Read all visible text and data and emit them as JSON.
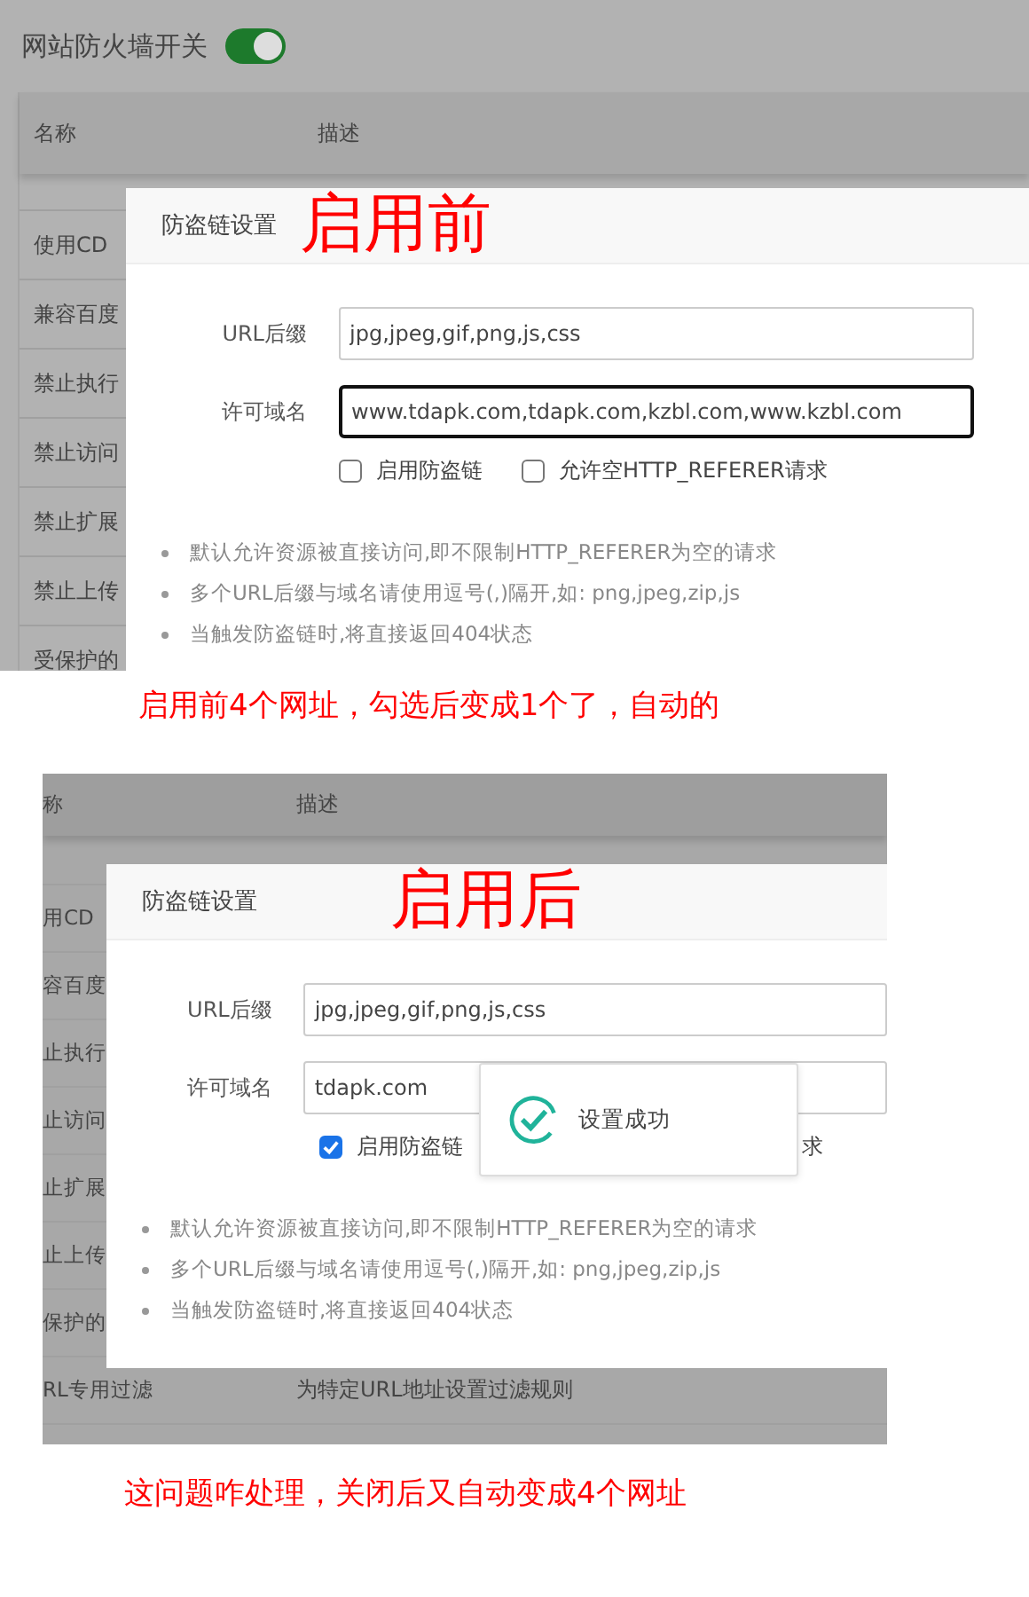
{
  "panels": [
    {
      "switch": {
        "label": "网站防火墙开关",
        "on": true
      },
      "columns": [
        "名称",
        "描述"
      ],
      "rows": [
        {
          "name": "使用CD"
        },
        {
          "name": "兼容百度"
        },
        {
          "name": "禁止执行"
        },
        {
          "name": "禁止访问"
        },
        {
          "name": "禁止扩展"
        },
        {
          "name": "禁止上传"
        },
        {
          "name": "受保护的"
        }
      ],
      "dialog": {
        "title": "防盗链设置",
        "stamp": "启用前",
        "url_suffix": {
          "label": "URL后缀",
          "value": "jpg,jpeg,gif,png,js,css"
        },
        "domains": {
          "label": "许可域名",
          "value": "www.tdapk.com,tdapk.com,kzbl.com,www.kzbl.com",
          "focused": true
        },
        "checkboxes": [
          {
            "label": "启用防盗链",
            "checked": false
          },
          {
            "label": "允许空HTTP_REFERER请求",
            "checked": false
          }
        ],
        "notes": [
          "默认允许资源被直接访问,即不限制HTTP_REFERER为空的请求",
          "多个URL后缀与域名请使用逗号(,)隔开,如: png,jpeg,zip,js",
          "当触发防盗链时,将直接返回404状态"
        ]
      },
      "caption": "启用前4个网址，勾选后变成1个了，自动的"
    },
    {
      "columns": [
        "称",
        "描述"
      ],
      "rows": [
        {
          "name": "用CD"
        },
        {
          "name": "容百度"
        },
        {
          "name": "止执行"
        },
        {
          "name": "止访问"
        },
        {
          "name": "止扩展"
        },
        {
          "name": "止上传"
        },
        {
          "name": "保护的"
        }
      ],
      "rows_after": [
        {
          "name": "RL专用过滤",
          "description": "为特定URL地址设置过滤规则"
        }
      ],
      "dialog": {
        "title": "防盗链设置",
        "stamp": "启用后",
        "url_suffix": {
          "label": "URL后缀",
          "value": "jpg,jpeg,gif,png,js,css"
        },
        "domains": {
          "label": "许可域名",
          "value": "tdapk.com",
          "focused": false
        },
        "checkboxes": [
          {
            "label": "启用防盗链",
            "checked": true
          }
        ],
        "hidden_label_tail": "求",
        "toast": {
          "text": "设置成功"
        },
        "notes": [
          "默认允许资源被直接访问,即不限制HTTP_REFERER为空的请求",
          "多个URL后缀与域名请使用逗号(,)隔开,如: png,jpeg,zip,js",
          "当触发防盗链时,将直接返回404状态"
        ]
      },
      "caption": "这问题咋处理，关闭后又自动变成4个网址"
    }
  ]
}
